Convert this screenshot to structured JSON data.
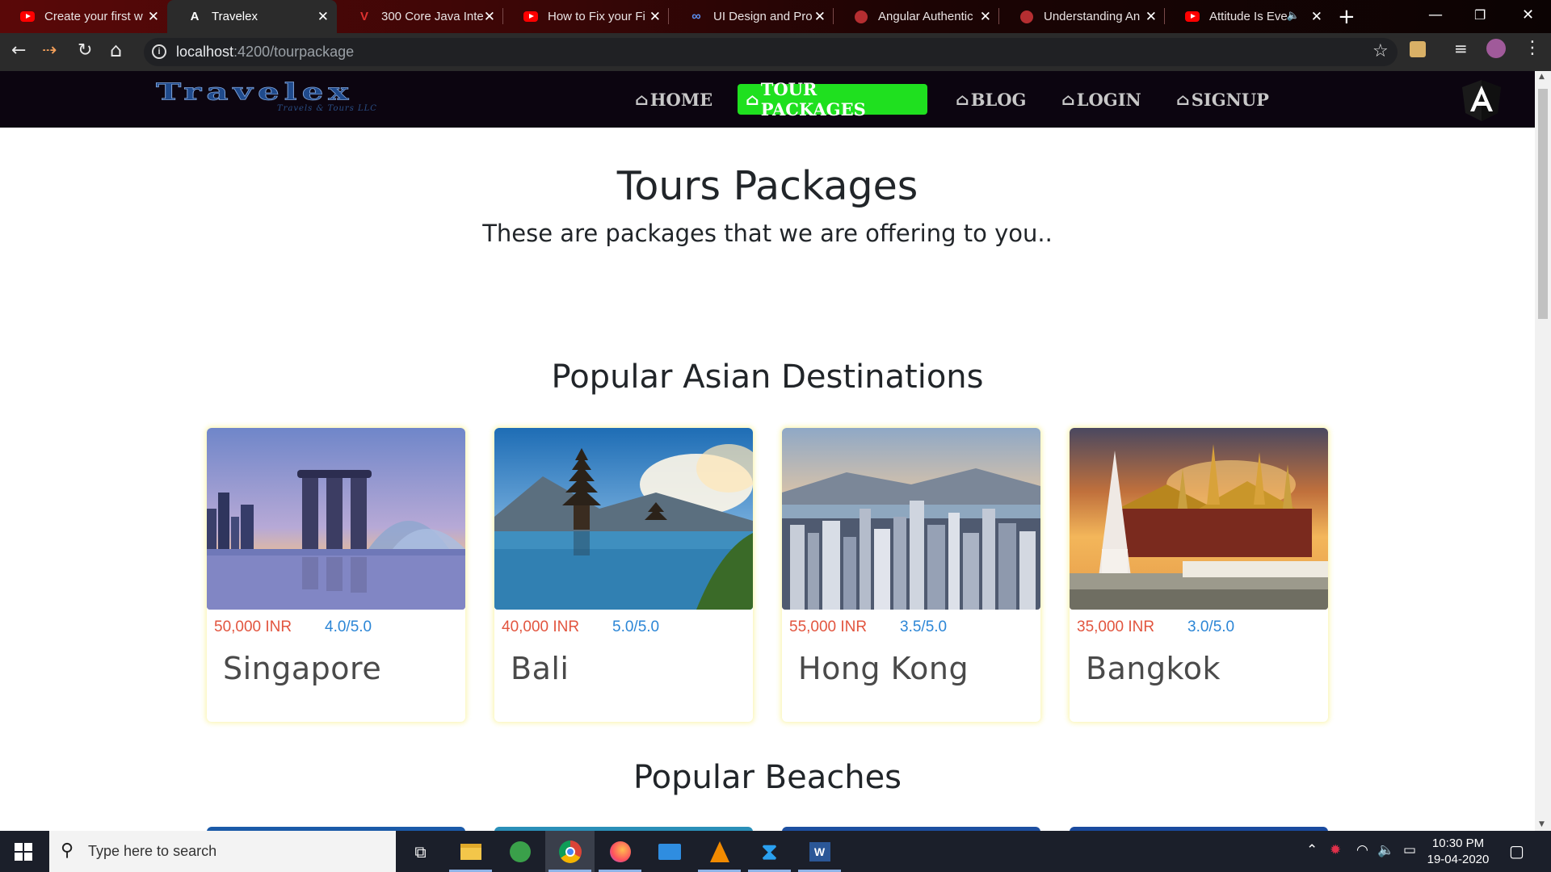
{
  "browser": {
    "tabs": [
      {
        "title": "Create your first w",
        "icon": "youtube-icon",
        "active": false
      },
      {
        "title": "Travelex",
        "icon": "angular-icon",
        "active": true
      },
      {
        "title": "300 Core Java Inte",
        "icon": "vue-icon",
        "active": false
      },
      {
        "title": "How to Fix your Fi",
        "icon": "youtube-icon",
        "active": false
      },
      {
        "title": "UI Design and Pro",
        "icon": "infinity-icon",
        "active": false
      },
      {
        "title": "Angular Authentic",
        "icon": "angular-shield-icon",
        "active": false
      },
      {
        "title": "Understanding An",
        "icon": "angular-shield-icon",
        "active": false
      },
      {
        "title": "Attitude Is Eve",
        "icon": "youtube-icon",
        "active": false,
        "muted": true
      }
    ],
    "url_host": "localhost",
    "url_path": ":4200/tourpackage"
  },
  "nav": {
    "logo_text": "Travelex",
    "logo_tagline": "Travels & Tours LLC",
    "links": [
      {
        "label": "HOME",
        "active": false
      },
      {
        "label": "TOUR PACKAGES",
        "active": true
      },
      {
        "label": "BLOG",
        "active": false
      },
      {
        "label": "LOGIN",
        "active": false
      },
      {
        "label": "SIGNUP",
        "active": false
      }
    ]
  },
  "page": {
    "title": "Tours Packages",
    "subtitle": "These are packages that we are offering to you..",
    "sections": [
      {
        "title": "Popular Asian Destinations",
        "cards": [
          {
            "price": "50,000 INR",
            "rating": "4.0/5.0",
            "city": "Singapore"
          },
          {
            "price": "40,000 INR",
            "rating": "5.0/5.0",
            "city": "Bali"
          },
          {
            "price": "55,000 INR",
            "rating": "3.5/5.0",
            "city": "Hong Kong"
          },
          {
            "price": "35,000 INR",
            "rating": "3.0/5.0",
            "city": "Bangkok"
          }
        ]
      },
      {
        "title": "Popular Beaches"
      }
    ]
  },
  "taskbar": {
    "search_placeholder": "Type here to search",
    "time": "10:30 PM",
    "date": "19-04-2020"
  },
  "colors": {
    "active_nav": "#1fe01f",
    "price": "#e2553f",
    "rating": "#2c86d6",
    "navbar_bg": "#0c0510"
  }
}
